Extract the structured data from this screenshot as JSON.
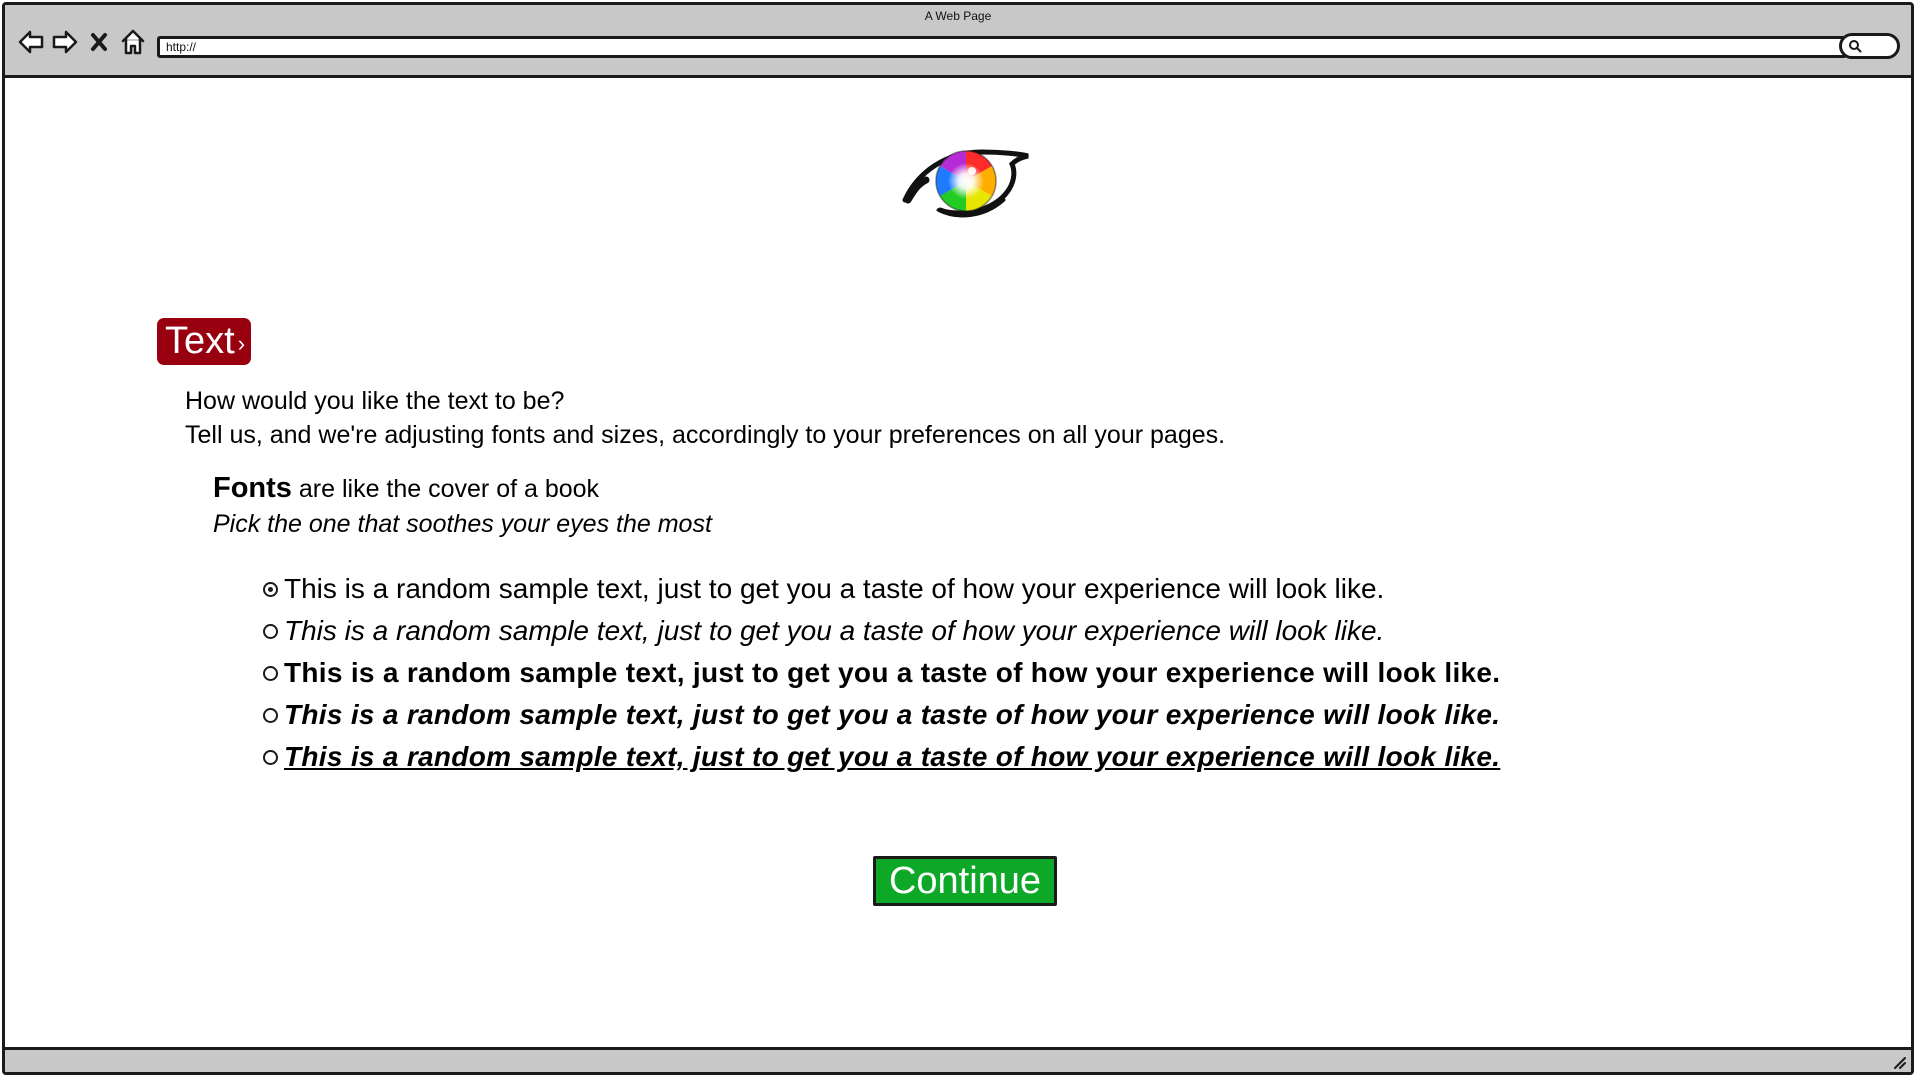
{
  "window": {
    "title": "A Web Page"
  },
  "toolbar": {
    "back_icon": "back-arrow-icon",
    "forward_icon": "forward-arrow-icon",
    "stop_icon": "close-icon",
    "home_icon": "home-icon",
    "address": "http://",
    "search_icon": "search-icon"
  },
  "logo": {
    "icon": "rainbow-eye-icon"
  },
  "section": {
    "badge_label": "Text",
    "badge_chevron": "›",
    "question": "How would you like the text to be?",
    "description": "Tell us, and we're adjusting fonts and sizes, accordingly to your preferences on all your pages."
  },
  "fonts": {
    "heading_bold": "Fonts",
    "heading_rest": " are like the cover of a book",
    "subheading": "Pick the one that soothes your eyes the most"
  },
  "font_options": [
    {
      "label": "This is a random sample text, just to get you a taste of how your experience will look like.",
      "style": "regular",
      "selected": true
    },
    {
      "label": "This is a random sample text, just to get you a taste of how your experience will look like.",
      "style": "italic",
      "selected": false
    },
    {
      "label": "This is a random sample text, just to get you a taste of how your experience will look like.",
      "style": "bold",
      "selected": false
    },
    {
      "label": "This is a random sample text, just to get you a taste of how your experience will look like.",
      "style": "bold-italic",
      "selected": false
    },
    {
      "label": "This is a random sample text, just to get you a taste of how your experience will look like.",
      "style": "bold-italic-underline",
      "selected": false
    }
  ],
  "actions": {
    "continue_label": "Continue"
  },
  "colors": {
    "badge_background": "#99000f",
    "continue_background": "#0ea829",
    "chrome_gray": "#c8c8c8"
  }
}
